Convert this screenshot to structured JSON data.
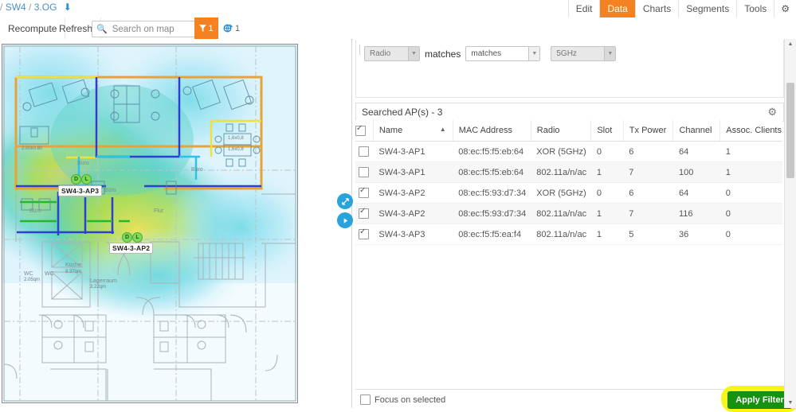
{
  "topbar": {
    "breadcrumb": {
      "prefix": "/",
      "site": "SW4",
      "floor": "3.OG",
      "download_icon": "download-arrow-icon"
    },
    "tabs": [
      {
        "label": "Edit",
        "active": false
      },
      {
        "label": "Data",
        "active": true
      },
      {
        "label": "Charts",
        "active": false
      },
      {
        "label": "Segments",
        "active": false
      },
      {
        "label": "Tools",
        "active": false
      }
    ],
    "settings_icon": "gear-icon"
  },
  "toolbar": {
    "recompute_label": "Recompute",
    "refresh_label": "Refresh",
    "search_placeholder": "Search on map",
    "search_value": "",
    "search_icon": "search-icon",
    "filter_icon": "funnel-icon",
    "filter_count": "1",
    "overlay_icon": "globe-pin-icon",
    "overlay_count": "1"
  },
  "filter": {
    "field_value": "Radio",
    "matches_label": "matches",
    "operator_value": "matches",
    "value_value": "5GHz"
  },
  "results": {
    "title": "Searched AP(s) - 3",
    "settings_icon": "gear-icon"
  },
  "table": {
    "header_checkbox_checked": true,
    "columns": [
      {
        "label": "Name",
        "sorted": true,
        "sort_dir": "asc"
      },
      {
        "label": "MAC Address",
        "sorted": false
      },
      {
        "label": "Radio",
        "sorted": false
      },
      {
        "label": "Slot",
        "sorted": false
      },
      {
        "label": "Tx Power",
        "sorted": false
      },
      {
        "label": "Channel",
        "sorted": false
      },
      {
        "label": "Assoc. Clients",
        "sorted": false
      }
    ],
    "rows": [
      {
        "checked": false,
        "name": "SW4-3-AP1",
        "mac": "08:ec:f5:f5:eb:64",
        "radio": "XOR (5GHz)",
        "slot": "0",
        "tx_power": "6",
        "channel": "64",
        "clients": "1"
      },
      {
        "checked": false,
        "name": "SW4-3-AP1",
        "mac": "08:ec:f5:f5:eb:64",
        "radio": "802.11a/n/ac",
        "slot": "1",
        "tx_power": "7",
        "channel": "100",
        "clients": "1"
      },
      {
        "checked": true,
        "name": "SW4-3-AP2",
        "mac": "08:ec:f5:93:d7:34",
        "radio": "XOR (5GHz)",
        "slot": "0",
        "tx_power": "6",
        "channel": "64",
        "clients": "0"
      },
      {
        "checked": true,
        "name": "SW4-3-AP2",
        "mac": "08:ec:f5:93:d7:34",
        "radio": "802.11a/n/ac",
        "slot": "1",
        "tx_power": "7",
        "channel": "116",
        "clients": "0"
      },
      {
        "checked": true,
        "name": "SW4-3-AP3",
        "mac": "08:ec:f5:f5:ea:f4",
        "radio": "802.11a/n/ac",
        "slot": "1",
        "tx_power": "5",
        "channel": "36",
        "clients": "0"
      }
    ]
  },
  "footer": {
    "focus_label": "Focus on selected",
    "focus_checked": false,
    "apply_label": "Apply Filter",
    "highlight_color": "#f7f518",
    "apply_color": "#15920f"
  },
  "map": {
    "ap_markers": [
      {
        "label": "SW4-3-AP3"
      },
      {
        "label": "SW4-3-AP2"
      }
    ],
    "room_labels": [
      "Büro",
      "Büro",
      "Büro",
      "Büro",
      "Flur",
      "Küche",
      "Lagerraum",
      "WC",
      "WC"
    ],
    "dimension_labels": [
      "2.00x0.80",
      "1,6x0,8",
      "1,6x0,8",
      "8.37qm",
      "3.22qm",
      "2.05qm"
    ],
    "expand_icon": "expand-arrows-icon",
    "collapse_icon": "play-right-icon"
  },
  "colors": {
    "accent_orange": "#f58220",
    "link_blue": "#4a90c4",
    "handle_blue": "#29a3dc"
  }
}
